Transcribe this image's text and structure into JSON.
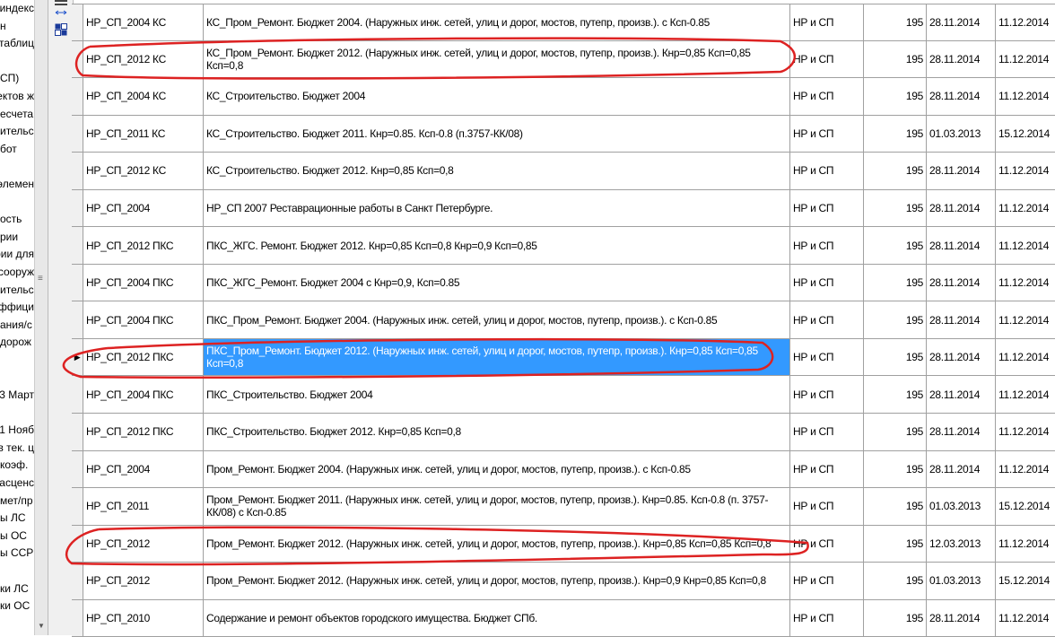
{
  "left_panel": [
    "н индекс",
    "н",
    "таблиц",
    "",
    "СП)",
    "ектов ж",
    "есчета",
    "ительс",
    "бот",
    "",
    "элемен",
    "",
    "ость",
    "рии",
    "рии для",
    "сооруж",
    "ительс",
    "ффици",
    "ания/с",
    "дорож",
    "",
    "",
    "3 Март",
    "",
    "1 Нояб",
    "в тек. ц",
    "коэф.",
    "расценс",
    "мет/пр",
    "ы ЛС",
    "ы ОС",
    "ы ССР",
    "",
    "ки ЛС",
    "ки ОС"
  ],
  "selected_row_marker": "▶",
  "rows": [
    {
      "code": "НР_СП_2004 КС",
      "name": "КС_Пром_Ремонт. Бюджет 2004. (Наружных инж. сетей, улиц и дорог, мостов, путепр, произв.). с Ксп-0.85",
      "type": "НР и СП",
      "num": "195",
      "date1": "28.11.2014",
      "date2": "11.12.2014"
    },
    {
      "code": "НР_СП_2012 КС",
      "name": "КС_Пром_Ремонт. Бюджет 2012. (Наружных инж. сетей, улиц и дорог, мостов, путепр, произв.). Кнр=0,85 Ксп=0,85 Ксп=0,8",
      "type": "НР и СП",
      "num": "195",
      "date1": "28.11.2014",
      "date2": "11.12.2014"
    },
    {
      "code": "НР_СП_2004 КС",
      "name": "КС_Строительство. Бюджет 2004",
      "type": "НР и СП",
      "num": "195",
      "date1": "28.11.2014",
      "date2": "11.12.2014"
    },
    {
      "code": "НР_СП_2011 КС",
      "name": "КС_Строительство. Бюджет 2011. Кнр=0.85. Ксп-0.8 (п.3757-КК/08)",
      "type": "НР и СП",
      "num": "195",
      "date1": "01.03.2013",
      "date2": "15.12.2014"
    },
    {
      "code": "НР_СП_2012 КС",
      "name": "КС_Строительство. Бюджет 2012. Кнр=0,85 Ксп=0,8",
      "type": "НР и СП",
      "num": "195",
      "date1": "28.11.2014",
      "date2": "11.12.2014"
    },
    {
      "code": "НР_СП_2004",
      "name": "НР_СП 2007 Реставрационные работы в Санкт Петербурге.",
      "type": "НР и СП",
      "num": "195",
      "date1": "28.11.2014",
      "date2": "11.12.2014"
    },
    {
      "code": "НР_СП_2012 ПКС",
      "name": "ПКС_ЖГС. Ремонт. Бюджет 2012. Кнр=0,85 Ксп=0,8 Кнр=0,9 Ксп=0,85",
      "type": "НР и СП",
      "num": "195",
      "date1": "28.11.2014",
      "date2": "11.12.2014"
    },
    {
      "code": "НР_СП_2004 ПКС",
      "name": "ПКС_ЖГС_Ремонт. Бюджет 2004 с Кнр=0,9, Ксп=0.85",
      "type": "НР и СП",
      "num": "195",
      "date1": "28.11.2014",
      "date2": "11.12.2014"
    },
    {
      "code": "НР_СП_2004 ПКС",
      "name": "ПКС_Пром_Ремонт. Бюджет 2004. (Наружных инж. сетей, улиц и дорог, мостов, путепр, произв.). с Ксп-0.85",
      "type": "НР и СП",
      "num": "195",
      "date1": "28.11.2014",
      "date2": "11.12.2014"
    },
    {
      "code": "НР_СП_2012 ПКС",
      "name": "ПКС_Пром_Ремонт. Бюджет 2012. (Наружных инж. сетей, улиц и дорог, мостов, путепр, произв.). Кнр=0,85 Ксп=0,85 Ксп=0,8",
      "type": "НР и СП",
      "num": "195",
      "date1": "28.11.2014",
      "date2": "11.12.2014",
      "selected": true
    },
    {
      "code": "НР_СП_2004 ПКС",
      "name": "ПКС_Строительство. Бюджет 2004",
      "type": "НР и СП",
      "num": "195",
      "date1": "28.11.2014",
      "date2": "11.12.2014"
    },
    {
      "code": "НР_СП_2012 ПКС",
      "name": "ПКС_Строительство. Бюджет 2012. Кнр=0,85 Ксп=0,8",
      "type": "НР и СП",
      "num": "195",
      "date1": "28.11.2014",
      "date2": "11.12.2014"
    },
    {
      "code": "НР_СП_2004",
      "name": "Пром_Ремонт. Бюджет 2004. (Наружных инж. сетей, улиц и дорог, мостов, путепр, произв.). с Ксп-0.85",
      "type": "НР и СП",
      "num": "195",
      "date1": "28.11.2014",
      "date2": "11.12.2014"
    },
    {
      "code": "НР_СП_2011",
      "name": "Пром_Ремонт. Бюджет 2011. (Наружных инж. сетей, улиц и дорог, мостов, путепр, произв.). Кнр=0.85. Ксп-0.8 (п. 3757-КК/08) с Ксп-0.85",
      "type": "НР и СП",
      "num": "195",
      "date1": "01.03.2013",
      "date2": "15.12.2014"
    },
    {
      "code": "НР_СП_2012",
      "name": "Пром_Ремонт. Бюджет 2012. (Наружных инж. сетей, улиц и дорог, мостов, путепр, произв.). Кнр=0,85 Ксп=0,85 Ксп=0,8",
      "type": "НР и СП",
      "num": "195",
      "date1": "12.03.2013",
      "date2": "11.12.2014"
    },
    {
      "code": "НР_СП_2012",
      "name": "Пром_Ремонт. Бюджет 2012. (Наружных инж. сетей, улиц и дорог, мостов, путепр, произв.). Кнр=0,9 Кнр=0,85 Ксп=0,8",
      "type": "НР и СП",
      "num": "195",
      "date1": "01.03.2013",
      "date2": "15.12.2014"
    },
    {
      "code": "НР_СП_2010",
      "name": "Содержание и ремонт объектов городского имущества. Бюджет СПб.",
      "type": "НР и СП",
      "num": "195",
      "date1": "28.11.2014",
      "date2": "11.12.2014"
    }
  ]
}
